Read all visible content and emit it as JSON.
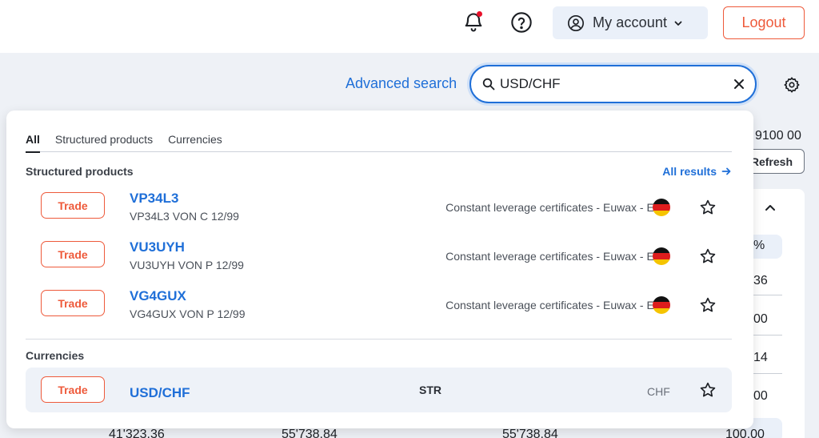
{
  "header": {
    "account_label": "My account",
    "logout_label": "Logout",
    "notification_badge_color": "#e8102a"
  },
  "search": {
    "advanced_label": "Advanced search",
    "query": "USD/CHF"
  },
  "background": {
    "top_value": "9100 00",
    "refresh_label": "Refresh",
    "side_values": [
      "%",
      "36",
      "00",
      "14",
      "00",
      "100.00"
    ],
    "bottom_values": [
      "41'323.36",
      "55'738.84",
      "55'738.84"
    ]
  },
  "dropdown": {
    "tabs": [
      {
        "label": "All",
        "active": true
      },
      {
        "label": "Structured products",
        "active": false
      },
      {
        "label": "Currencies",
        "active": false
      }
    ],
    "structured_title": "Structured products",
    "all_results_label": "All results",
    "trade_label": "Trade",
    "structured_items": [
      {
        "symbol": "VP34L3",
        "name": "VP34L3 VON C 12/99",
        "type": "Constant leverage certificates - Euwax - EUR",
        "flag": "germany-flag-icon"
      },
      {
        "symbol": "VU3UYH",
        "name": "VU3UYH VON P 12/99",
        "type": "Constant leverage certificates - Euwax - EUR",
        "flag": "germany-flag-icon"
      },
      {
        "symbol": "VG4GUX",
        "name": "VG4GUX VON P 12/99",
        "type": "Constant leverage certificates - Euwax - EUR",
        "flag": "germany-flag-icon"
      }
    ],
    "currencies_title": "Currencies",
    "currency_items": [
      {
        "symbol": "USD/CHF",
        "label": "STR",
        "currency": "CHF"
      }
    ]
  },
  "colors": {
    "accent_blue": "#1f6fd8",
    "trade_orange": "#ee5a3b"
  }
}
